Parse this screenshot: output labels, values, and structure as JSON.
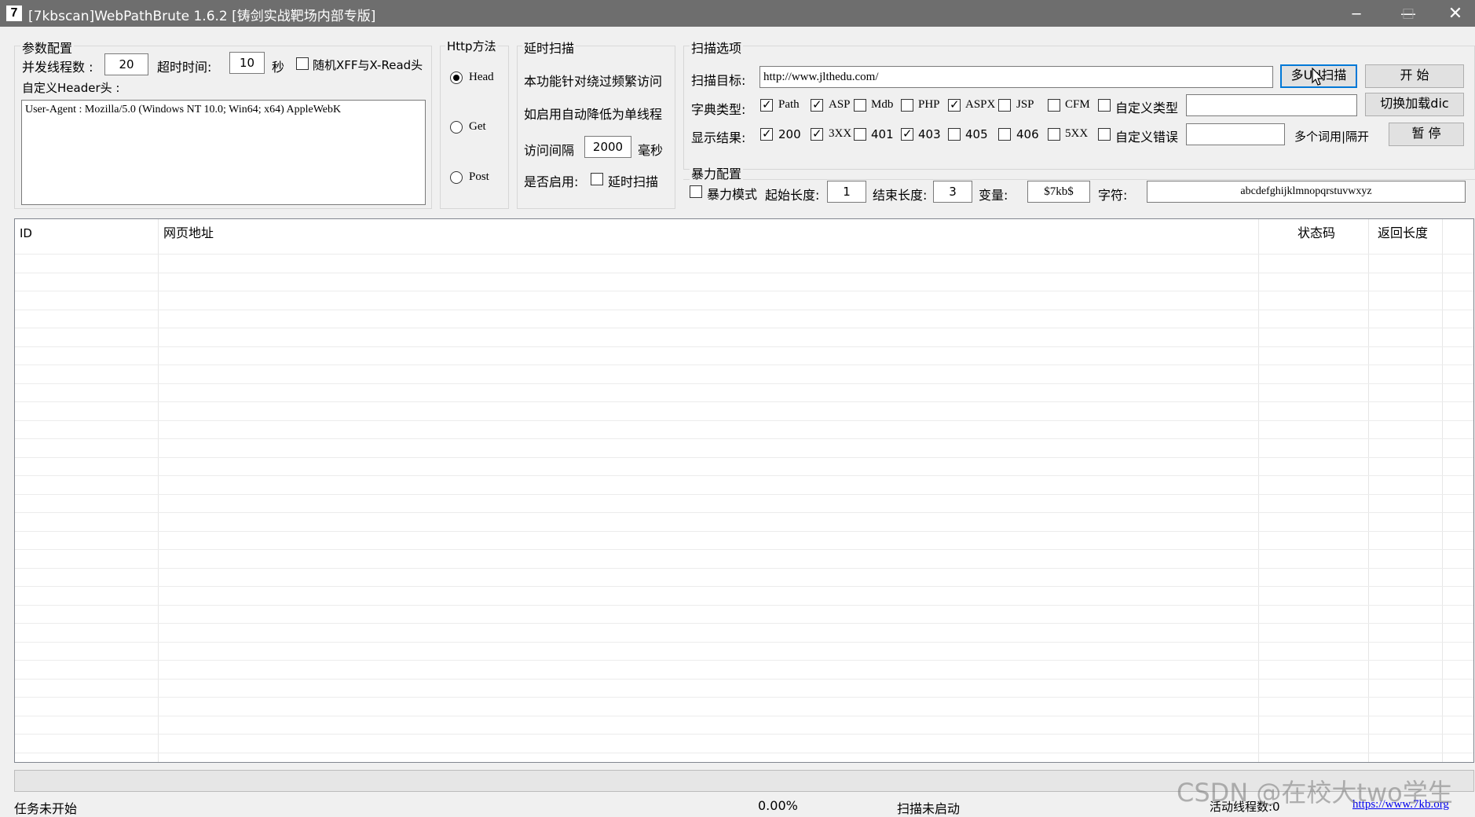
{
  "window": {
    "icon_text": "7",
    "title": "[7kbscan]WebPathBrute 1.6.2 [铸剑实战靶场内部专版]",
    "min_icon": "minimize-icon",
    "max_icon": "maximize-icon",
    "close_icon": "close-icon"
  },
  "params": {
    "legend": "参数配置",
    "threads_label": "并发线程数 :",
    "threads_value": "20",
    "timeout_label": "超时时间:",
    "timeout_value": "10",
    "timeout_unit": "秒",
    "random_xff_label": "随机XFF与X-Read头",
    "random_xff_checked": false,
    "header_label": "自定义Header头 :",
    "header_value": "User-Agent : Mozilla/5.0 (Windows NT 10.0; Win64; x64) AppleWebK"
  },
  "http_method": {
    "legend": "Http方法",
    "options": [
      "Head",
      "Get",
      "Post"
    ],
    "selected": "Head"
  },
  "delay_scan": {
    "legend": "延时扫描",
    "desc1": "本功能针对绕过频繁访问",
    "desc2": "如启用自动降低为单线程",
    "interval_label": "访问间隔",
    "interval_value": "2000",
    "interval_unit": "毫秒",
    "enable_label": "是否启用:",
    "enable_checkbox_label": "延时扫描",
    "enable_checked": false
  },
  "scan_options": {
    "legend": "扫描选项",
    "target_label": "扫描目标:",
    "target_value": "http://www.jlthedu.com/",
    "multi_url_button": "多Url扫描",
    "start_button": "开 始",
    "dict_label": "字典类型:",
    "dict_types": [
      {
        "label": "Path",
        "checked": true
      },
      {
        "label": "ASP",
        "checked": true
      },
      {
        "label": "Mdb",
        "checked": false
      },
      {
        "label": "PHP",
        "checked": false
      },
      {
        "label": "ASPX",
        "checked": true
      },
      {
        "label": "JSP",
        "checked": false
      },
      {
        "label": "CFM",
        "checked": false
      },
      {
        "label": "自定义类型",
        "checked": false
      }
    ],
    "custom_type_value": "",
    "switch_dict_button": "切换加载dic",
    "display_label": "显示结果:",
    "display_codes": [
      {
        "label": "200",
        "checked": true
      },
      {
        "label": "3XX",
        "checked": true
      },
      {
        "label": "401",
        "checked": false
      },
      {
        "label": "403",
        "checked": true
      },
      {
        "label": "405",
        "checked": false
      },
      {
        "label": "406",
        "checked": false
      },
      {
        "label": "5XX",
        "checked": false
      },
      {
        "label": "自定义错误",
        "checked": false
      }
    ],
    "custom_error_value": "",
    "multi_word_hint": "多个词用|隔开",
    "pause_button": "暂 停"
  },
  "brute": {
    "legend": "暴力配置",
    "mode_label": "暴力模式",
    "mode_checked": false,
    "start_len_label": "起始长度:",
    "start_len_value": "1",
    "end_len_label": "结束长度:",
    "end_len_value": "3",
    "var_label": "变量:",
    "var_value": "$7kb$",
    "chars_label": "字符:",
    "chars_value": "abcdefghijklmnopqrstuvwxyz"
  },
  "table": {
    "columns": [
      "ID",
      "网页地址",
      "状态码",
      "返回长度"
    ],
    "rows": []
  },
  "status_bar": {
    "task_status": "任务未开始",
    "progress": "0.00%",
    "progress_fraction": 0,
    "scan_status": "扫描未启动",
    "active_threads": "活动线程数:0",
    "website": "https://www.7kb.org"
  },
  "watermark": "CSDN @在校大two学生"
}
